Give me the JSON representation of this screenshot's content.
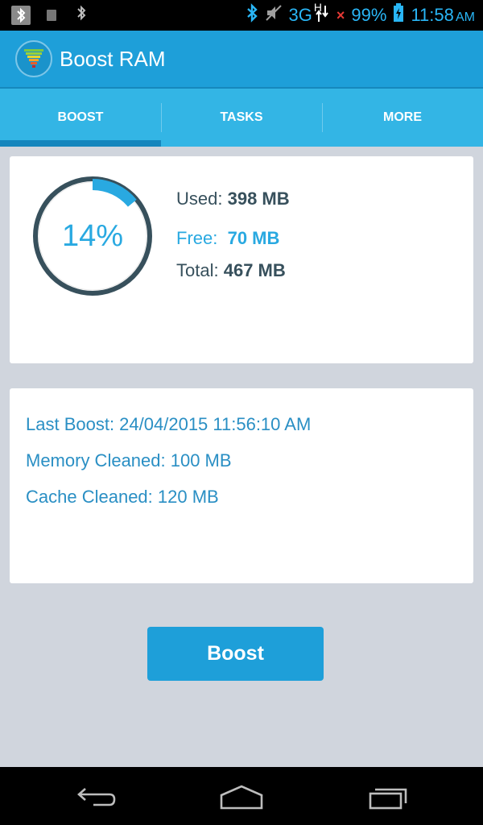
{
  "status_bar": {
    "network": "3G",
    "network_sub": "H",
    "battery": "99%",
    "time": "11:58",
    "time_suffix": "AM",
    "icons": [
      "bluetooth-icon",
      "notification-icon",
      "bluetooth-icon",
      "bluetooth-icon",
      "mute-icon",
      "signal-icon",
      "no-signal-icon",
      "battery-charging-icon"
    ]
  },
  "app_bar": {
    "title": "Boost RAM",
    "logo_icon": "funnel-logo-icon"
  },
  "tabs": [
    {
      "label": "BOOST",
      "active": true
    },
    {
      "label": "TASKS",
      "active": false
    },
    {
      "label": "MORE",
      "active": false
    }
  ],
  "memory": {
    "percent_label": "14%",
    "percent_value": 14,
    "used_label": "Used:",
    "used_value": "398 MB",
    "free_label": "Free:",
    "free_value": "70 MB",
    "total_label": "Total:",
    "total_value": "467 MB"
  },
  "history": {
    "last_boost": "Last Boost: 24/04/2015 11:56:10 AM",
    "memory_cleaned": "Memory Cleaned: 100 MB",
    "cache_cleaned": "Cache Cleaned: 120 MB"
  },
  "boost_button": {
    "label": "Boost"
  },
  "colors": {
    "accent": "#1e9fd9",
    "tab_bar": "#33b5e5",
    "gauge_track": "#37505c",
    "gauge_fill": "#29a9e1",
    "background": "#d0d5dd"
  },
  "nav_bar": {
    "icons": [
      "back-icon",
      "home-icon",
      "recent-apps-icon"
    ]
  }
}
